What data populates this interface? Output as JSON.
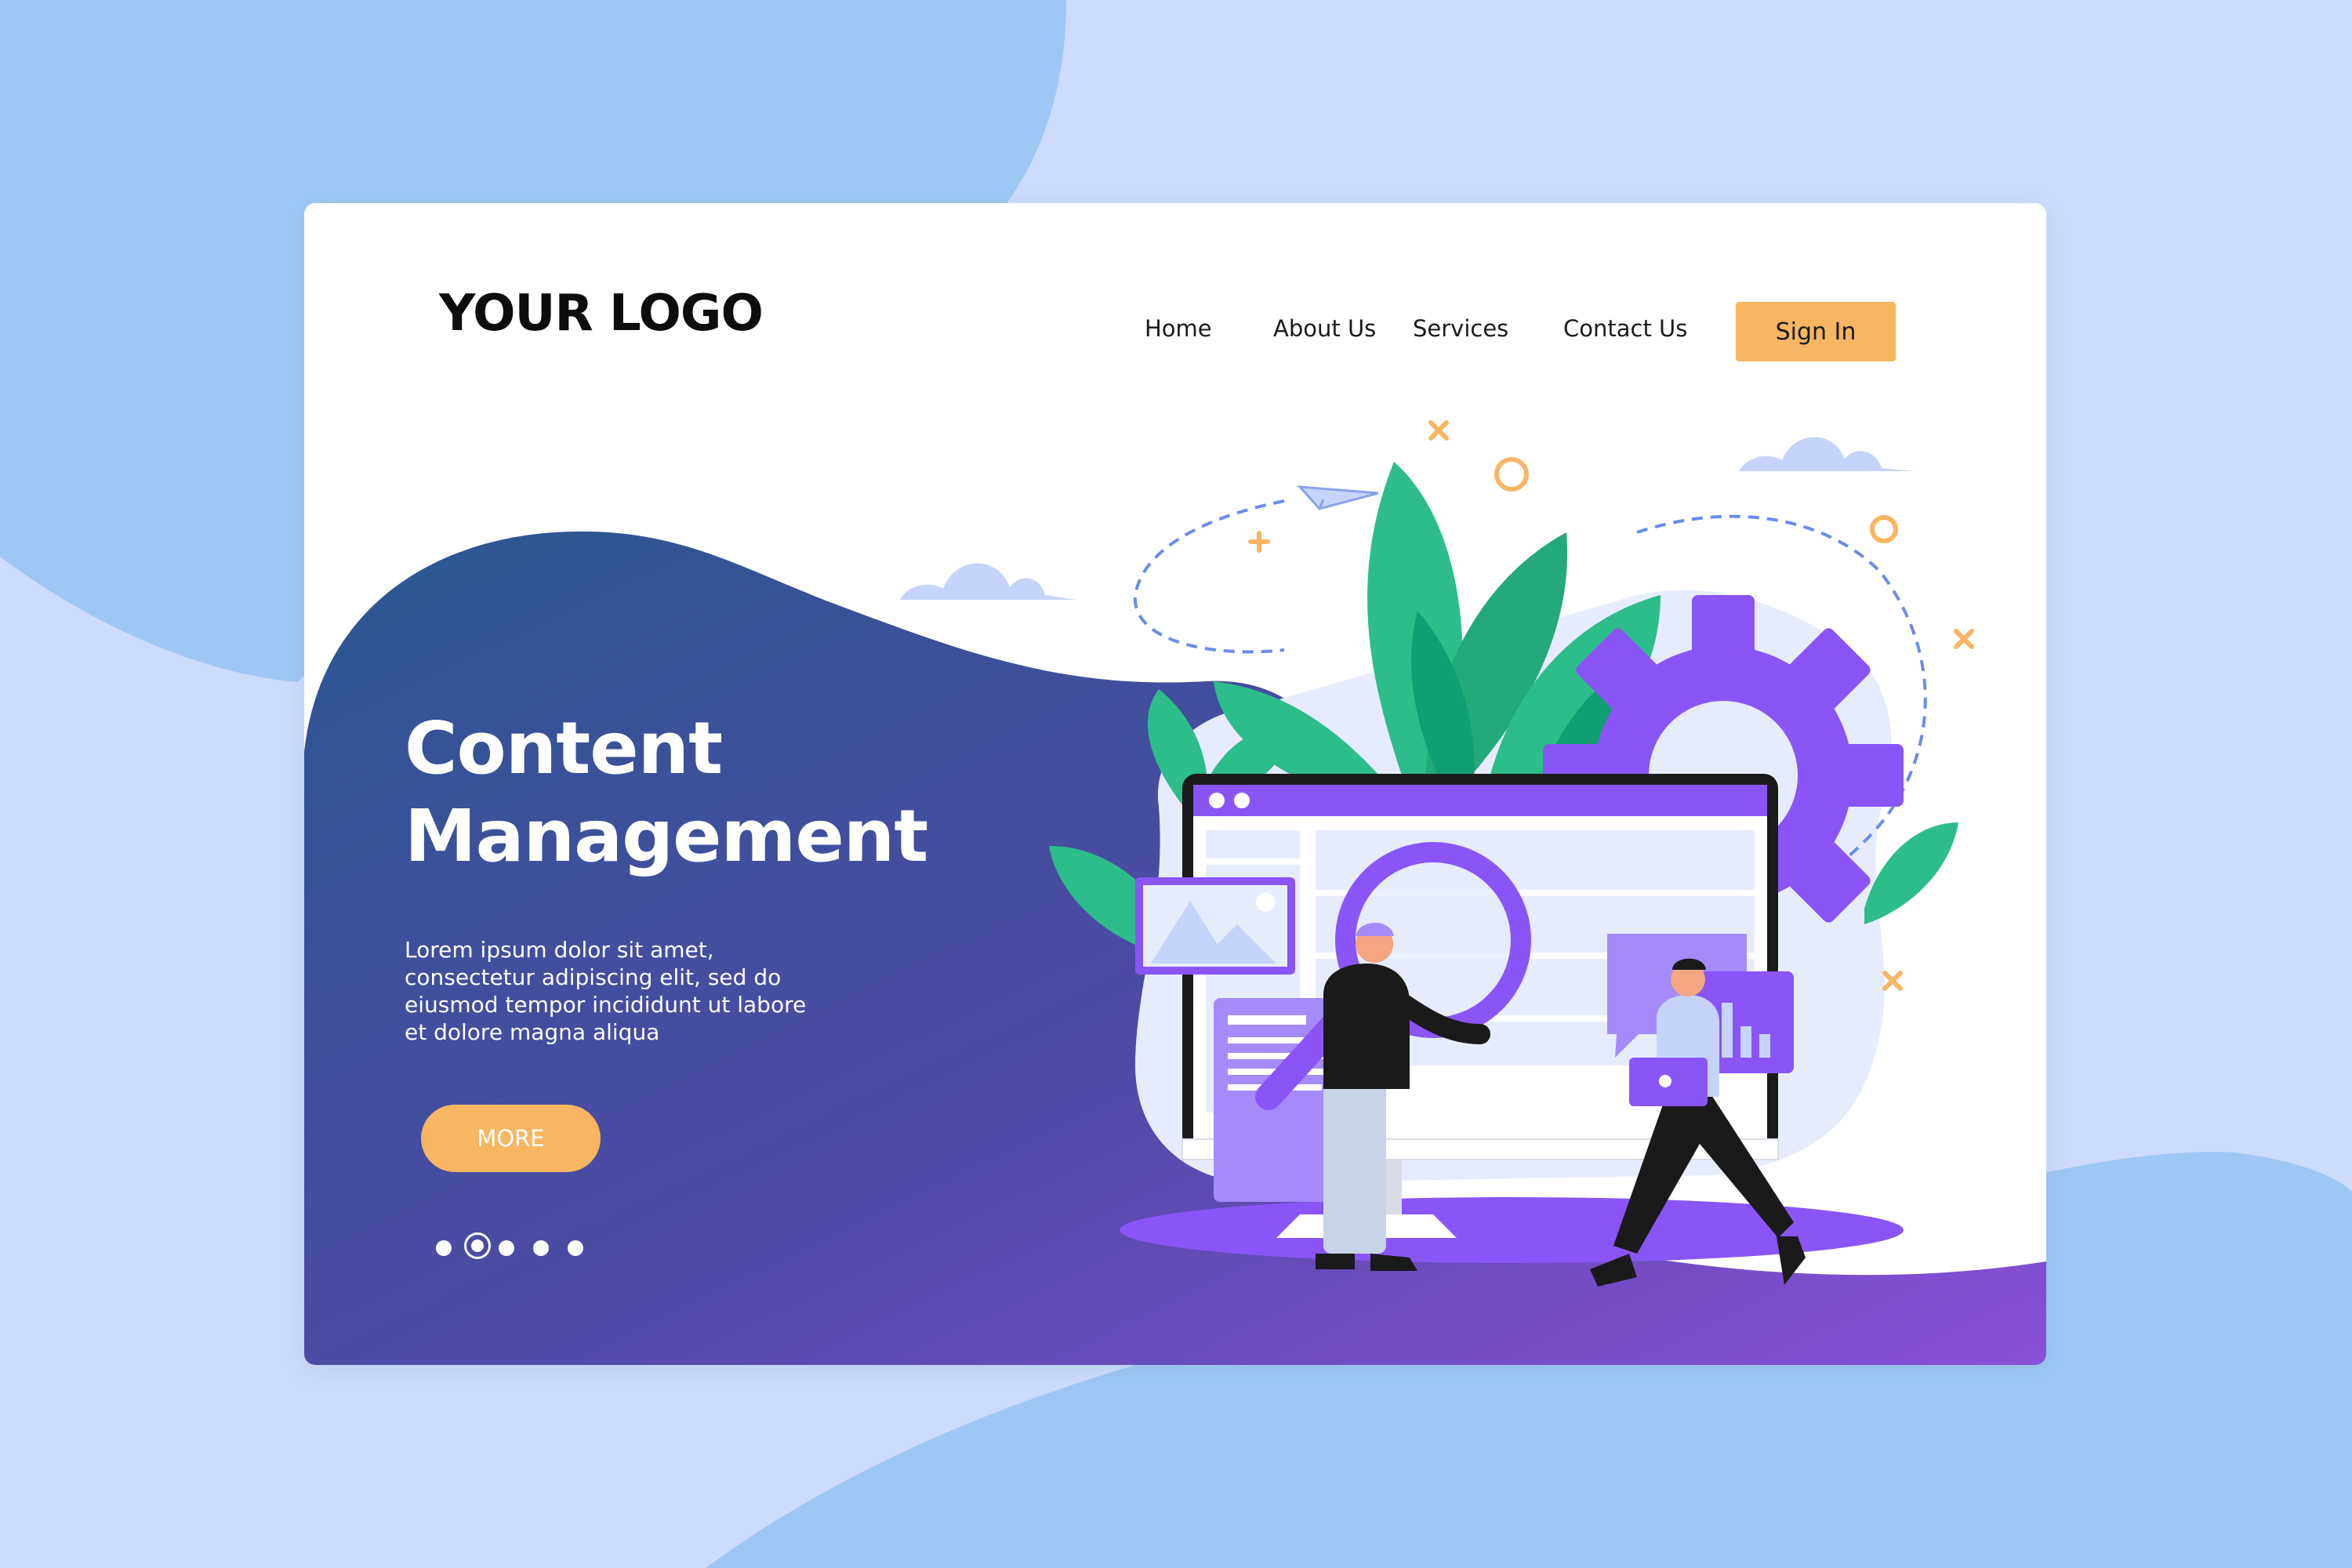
{
  "header": {
    "logo": "YOUR LOGO",
    "nav": [
      {
        "label": "Home"
      },
      {
        "label": "About Us"
      },
      {
        "label": "Services"
      },
      {
        "label": "Contact Us"
      }
    ],
    "sign_in": "Sign In"
  },
  "hero": {
    "title_line1": "Content",
    "title_line2": "Management",
    "body_line1": "Lorem ipsum dolor sit amet,",
    "body_line2": "consectetur adipiscing elit, sed do",
    "body_line3": "eiusmod tempor incididunt ut labore",
    "body_line4": "et dolore magna aliqua",
    "more_label": "MORE"
  },
  "carousel": {
    "count": 5,
    "active_index": 1
  },
  "colors": {
    "accent": "#f8b562",
    "primary_purple": "#8a55f6",
    "hero_gradient_start": "#2a5790",
    "hero_gradient_end": "#7c4fd0",
    "leaf_green": "#2dbd8a",
    "page_background": "#cddcfc"
  }
}
